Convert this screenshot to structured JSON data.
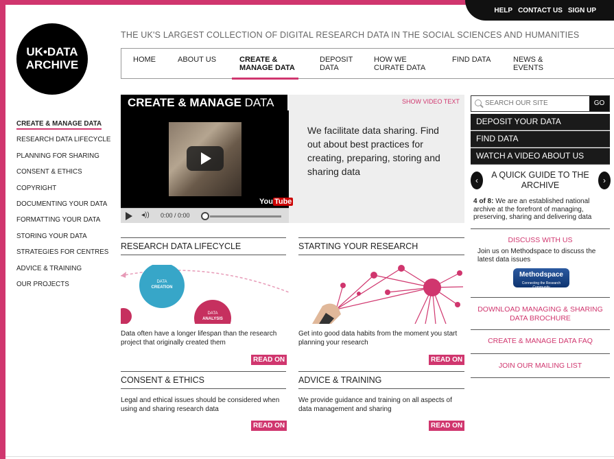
{
  "util_nav": [
    "HELP",
    "CONTACT US",
    "SIGN UP"
  ],
  "logo": {
    "line1": "UK•DATA",
    "line2": "ARCHIVE"
  },
  "tagline": "THE UK'S LARGEST COLLECTION OF DIGITAL RESEARCH DATA IN THE SOCIAL SCIENCES AND HUMANITIES",
  "top_nav": [
    {
      "l1": "HOME",
      "l2": ""
    },
    {
      "l1": "ABOUT US",
      "l2": ""
    },
    {
      "l1": "CREATE &",
      "l2": "MANAGE DATA"
    },
    {
      "l1": "DEPOSIT",
      "l2": "DATA"
    },
    {
      "l1": "HOW WE",
      "l2": "CURATE DATA"
    },
    {
      "l1": "FIND DATA",
      "l2": ""
    },
    {
      "l1": "NEWS &",
      "l2": "EVENTS"
    }
  ],
  "sidebar": [
    "CREATE & MANAGE DATA",
    "RESEARCH DATA LIFECYCLE",
    "PLANNING FOR SHARING",
    "CONSENT & ETHICS",
    "COPYRIGHT",
    "DOCUMENTING YOUR DATA",
    "FORMATTING YOUR DATA",
    "STORING YOUR DATA",
    "STRATEGIES FOR CENTRES",
    "ADVICE & TRAINING",
    "OUR PROJECTS"
  ],
  "hero": {
    "title_bold": "CREATE & MANAGE",
    "title_rest": " DATA",
    "show_video_text": "SHOW VIDEO TEXT",
    "description": "We facilitate data sharing. Find out about best practices for creating, preparing, storing and sharing data",
    "video": {
      "time": "0:00 / 0:00",
      "brand_you": "You",
      "brand_tube": "Tube"
    }
  },
  "blocks": {
    "rdl": {
      "title": "RESEARCH DATA LIFECYCLE",
      "desc": "Data often have a longer lifespan than the research project that originally created them",
      "read_on": "READ ON",
      "bubble1_a": "DATA",
      "bubble1_b": "CREATION",
      "bubble2_a": "DATA",
      "bubble2_b": "ANALYSIS"
    },
    "syr": {
      "title": "STARTING YOUR RESEARCH",
      "desc": "Get into good data habits from the moment you start planning your research",
      "read_on": "READ ON"
    },
    "ce": {
      "title": "CONSENT & ETHICS",
      "desc": "Legal and ethical issues should be considered when using and sharing research data",
      "read_on": "READ ON"
    },
    "at": {
      "title": "ADVICE & TRAINING",
      "desc": "We provide guidance and training on all aspects of data management and sharing",
      "read_on": "READ ON"
    }
  },
  "search": {
    "placeholder": "SEARCH OUR SITE",
    "go_label": "GO"
  },
  "right_links": [
    "DEPOSIT YOUR DATA",
    "FIND DATA",
    "WATCH A VIDEO ABOUT US"
  ],
  "quick_guide": {
    "title": "A QUICK GUIDE TO THE ARCHIVE",
    "counter": "4 of 8:",
    "text": " We are an established national archive at the forefront of managing, preserving, sharing and delivering data"
  },
  "discuss": {
    "title": "DISCUSS WITH US",
    "desc": "Join us on Methodspace to discuss the latest data issues",
    "badge": "Methodspace",
    "badge_sub": "Connecting the Research Community"
  },
  "right_text_links": [
    "DOWNLOAD MANAGING & SHARING DATA BROCHURE",
    "CREATE & MANAGE DATA FAQ",
    "JOIN OUR MAILING LIST"
  ],
  "colors": {
    "accent": "#d0366e",
    "dark": "#111111",
    "hero_bg": "#eeeeee"
  }
}
